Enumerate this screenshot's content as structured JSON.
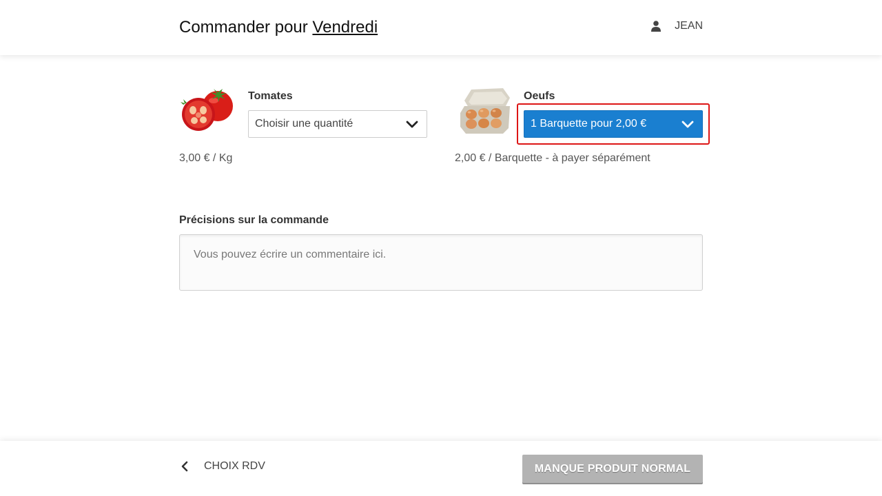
{
  "header": {
    "title_prefix": "Commander pour",
    "title_day": "Vendredi",
    "user_name": "JEAN",
    "user_icon": "user-icon"
  },
  "products": [
    {
      "name": "Tomates",
      "image": "tomato-image",
      "select_value": "Choisir une quantité",
      "price_text": "3,00 € / Kg",
      "selected": false
    },
    {
      "name": "Oeufs",
      "image": "egg-carton-image",
      "select_value": "1 Barquette pour 2,00 €",
      "price_text": "2,00 € / Barquette - à payer séparément",
      "selected": true
    }
  ],
  "notes": {
    "label": "Précisions sur la commande",
    "placeholder": "Vous pouvez écrire un commentaire ici."
  },
  "footer": {
    "back_label": "CHOIX RDV",
    "back_icon": "chevron-left-icon",
    "submit_label": "MANQUE PRODUIT NORMAL"
  },
  "colors": {
    "selected_select_bg": "#1a7fd0",
    "highlight_border": "#dd1515",
    "disabled_button": "#b3b3b3"
  }
}
